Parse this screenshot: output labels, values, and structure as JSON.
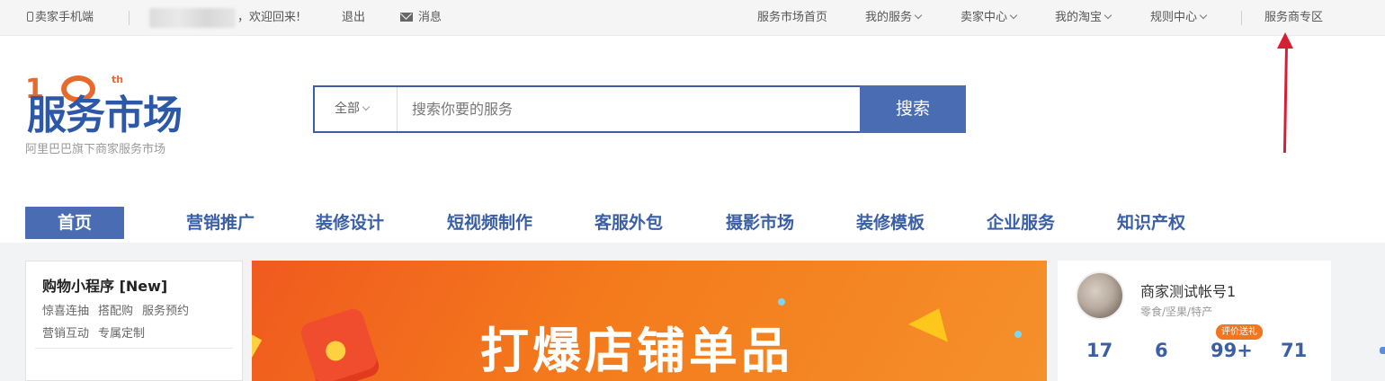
{
  "topbar": {
    "mobile_label": "卖家手机端",
    "welcome": "，欢迎回来!",
    "logout": "退出",
    "messages": "消息",
    "right_links": [
      {
        "label": "服务市场首页"
      },
      {
        "label": "我的服务"
      },
      {
        "label": "卖家中心"
      },
      {
        "label": "我的淘宝"
      },
      {
        "label": "规则中心"
      }
    ],
    "provider_zone": "服务商专区"
  },
  "logo": {
    "anniversary": "1",
    "anniversary_suffix": "th",
    "main": "服务市场",
    "subtitle": "阿里巴巴旗下商家服务市场"
  },
  "search": {
    "category": "全部",
    "placeholder": "搜索你要的服务",
    "button": "搜索"
  },
  "nav": {
    "tabs": [
      {
        "label": "首页",
        "active": true
      },
      {
        "label": "营销推广"
      },
      {
        "label": "装修设计"
      },
      {
        "label": "短视频制作"
      },
      {
        "label": "客服外包"
      },
      {
        "label": "摄影市场"
      },
      {
        "label": "装修模板"
      },
      {
        "label": "企业服务"
      },
      {
        "label": "知识产权"
      }
    ]
  },
  "left_card": {
    "title": "购物小程序 [New]",
    "row1": [
      "惊喜连抽",
      "搭配购",
      "服务预约"
    ],
    "row2": [
      "营销互动",
      "专属定制"
    ]
  },
  "banner": {
    "headline": "打爆店铺单品"
  },
  "account": {
    "name": "商家测试帐号1",
    "category": "零食/坚果/特产",
    "badge": "评价送礼",
    "stats": [
      "17",
      "6",
      "99+",
      "71"
    ]
  },
  "colors": {
    "brand_blue": "#4a6cb3",
    "logo_orange": "#e8692c",
    "annotation_red": "#d81e34",
    "banner_orange": "#f47b1c"
  }
}
